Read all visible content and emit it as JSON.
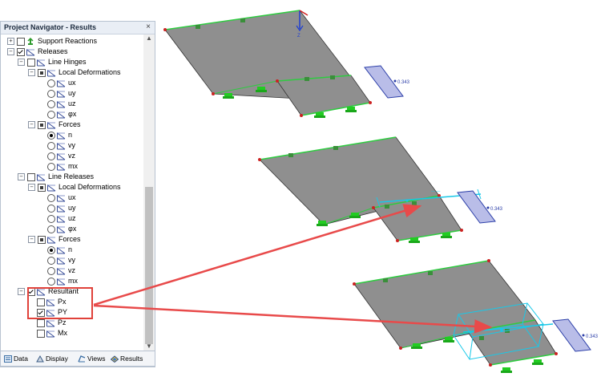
{
  "navigator": {
    "title": "Project Navigator - Results",
    "close_glyph": "×",
    "tree": [
      {
        "label": "Support Reactions",
        "level": 1,
        "check": "off",
        "expander": "+"
      },
      {
        "label": "Releases",
        "level": 1,
        "check": "on",
        "expander": "-"
      },
      {
        "label": "Line Hinges",
        "level": 2,
        "check": "off",
        "expander": "-"
      },
      {
        "label": "Local Deformations",
        "level": 3,
        "check": "part",
        "expander": "-"
      },
      {
        "label": "ux",
        "level": 4,
        "radio": "off"
      },
      {
        "label": "uy",
        "level": 4,
        "radio": "off"
      },
      {
        "label": "uz",
        "level": 4,
        "radio": "off"
      },
      {
        "label": "φx",
        "level": 4,
        "radio": "off"
      },
      {
        "label": "Forces",
        "level": 3,
        "check": "part",
        "expander": "-"
      },
      {
        "label": "n",
        "level": 4,
        "radio": "on"
      },
      {
        "label": "vy",
        "level": 4,
        "radio": "off"
      },
      {
        "label": "vz",
        "level": 4,
        "radio": "off"
      },
      {
        "label": "mx",
        "level": 4,
        "radio": "off"
      },
      {
        "label": "Line Releases",
        "level": 2,
        "check": "off",
        "expander": "-"
      },
      {
        "label": "Local Deformations",
        "level": 3,
        "check": "part",
        "expander": "-"
      },
      {
        "label": "ux",
        "level": 4,
        "radio": "off"
      },
      {
        "label": "uy",
        "level": 4,
        "radio": "off"
      },
      {
        "label": "uz",
        "level": 4,
        "radio": "off"
      },
      {
        "label": "φx",
        "level": 4,
        "radio": "off"
      },
      {
        "label": "Forces",
        "level": 3,
        "check": "part",
        "expander": "-"
      },
      {
        "label": "n",
        "level": 4,
        "radio": "on"
      },
      {
        "label": "vy",
        "level": 4,
        "radio": "off"
      },
      {
        "label": "vz",
        "level": 4,
        "radio": "off"
      },
      {
        "label": "mx",
        "level": 4,
        "radio": "off"
      },
      {
        "label": "Resultant",
        "level": 2,
        "check": "on",
        "expander": "-"
      },
      {
        "label": "Px",
        "level": 3,
        "check": "off"
      },
      {
        "label": "PY",
        "level": 3,
        "check": "on"
      },
      {
        "label": "Pz",
        "level": 3,
        "check": "off"
      },
      {
        "label": "Mx",
        "level": 3,
        "check": "off"
      }
    ],
    "tabs": [
      {
        "label": "Data",
        "icon": "data-icon"
      },
      {
        "label": "Display",
        "icon": "display-icon"
      },
      {
        "label": "Views",
        "icon": "views-icon"
      },
      {
        "label": "Results",
        "icon": "results-icon"
      }
    ]
  },
  "scene": {
    "axis_label": "Z",
    "value_labels": [
      "0.343",
      "0.343",
      "0.343"
    ],
    "colors": {
      "plate": "#8f8f8f",
      "edge_green": "#2ecc40",
      "support_green": "#22cc22",
      "release_fill": "#b9bde8",
      "release_edge": "#2b3ea8",
      "resultant_cyan": "#18c8e8",
      "arrow_red": "#e84a4a"
    }
  }
}
